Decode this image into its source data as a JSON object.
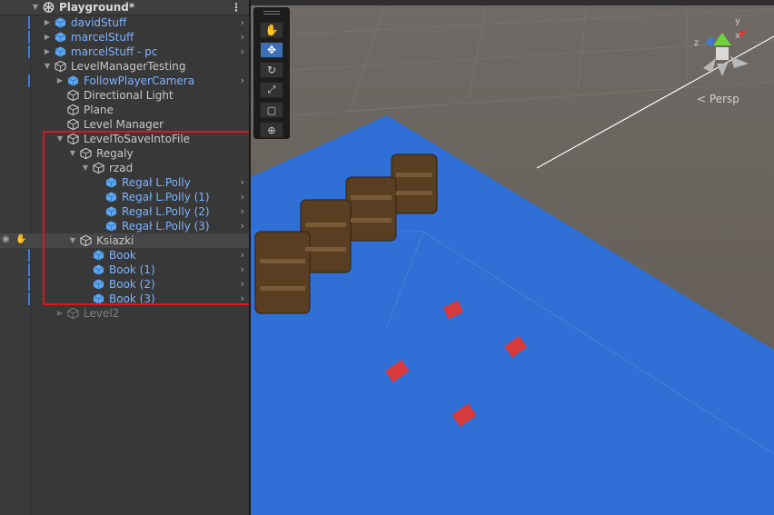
{
  "hierarchy": {
    "scene_name": "Playground*",
    "rows": [
      {
        "label": "davidStuff",
        "style": "prefab"
      },
      {
        "label": "marcelStuff",
        "style": "prefab"
      },
      {
        "label": "marcelStuff - pc",
        "style": "prefab"
      },
      {
        "label": "LevelManagerTesting",
        "style": "object"
      },
      {
        "label": "FollowPlayerCamera",
        "style": "prefab"
      },
      {
        "label": "Directional Light",
        "style": "object"
      },
      {
        "label": "Plane",
        "style": "object"
      },
      {
        "label": "Level Manager",
        "style": "object"
      },
      {
        "label": "LevelToSaveIntoFile",
        "style": "object"
      },
      {
        "label": "Regaly",
        "style": "object"
      },
      {
        "label": "rzad",
        "style": "object"
      },
      {
        "label": "Regał L.Polly",
        "style": "prefab"
      },
      {
        "label": "Regał L.Polly (1)",
        "style": "prefab"
      },
      {
        "label": "Regał L.Polly (2)",
        "style": "prefab"
      },
      {
        "label": "Regał L.Polly (3)",
        "style": "prefab"
      },
      {
        "label": "Ksiazki",
        "style": "object"
      },
      {
        "label": "Book",
        "style": "prefab"
      },
      {
        "label": "Book (1)",
        "style": "prefab"
      },
      {
        "label": "Book (2)",
        "style": "prefab"
      },
      {
        "label": "Book (3)",
        "style": "prefab"
      },
      {
        "label": "Level2",
        "style": "disabled"
      }
    ]
  },
  "scene_view": {
    "projection_label": "Persp",
    "gizmo_axes": [
      "y",
      "x",
      "z"
    ],
    "tools": [
      "view-tool",
      "move-tool",
      "rotate-tool",
      "scale-tool",
      "rect-tool",
      "transform-tool"
    ],
    "active_tool": "move-tool"
  },
  "colors": {
    "selection_highlight": "#e0151b",
    "prefab_text": "#7cb3ff",
    "plane": "#2f6fd6",
    "background_ground": "#6b635b"
  }
}
